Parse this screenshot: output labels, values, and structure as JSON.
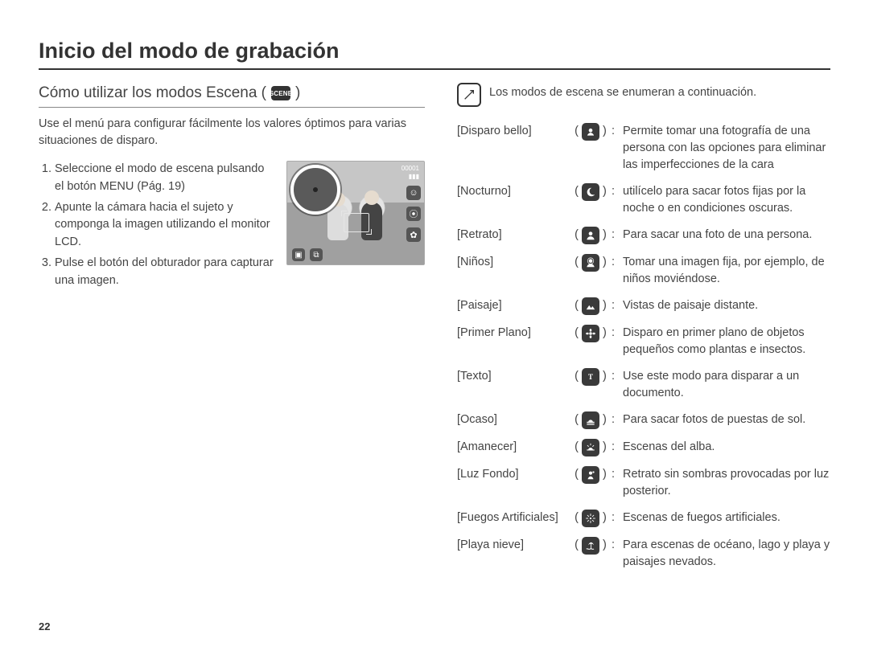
{
  "title": "Inicio del modo de grabación",
  "subheading_prefix": "Cómo utilizar los modos Escena (",
  "subheading_suffix": ")",
  "scene_badge": "SCENE",
  "intro": "Use el menú para configurar fácilmente los valores óptimos para varias situaciones de disparo.",
  "steps": [
    "Seleccione el modo de escena pulsando el botón MENU (Pág. 19)",
    "Apunte la cámara hacia el sujeto y componga la imagen utilizando el monitor LCD.",
    "Pulse el botón del obturador para capturar una imagen."
  ],
  "lcd": {
    "counter": "00001",
    "battery": "▮▮▮"
  },
  "note_text": "Los modos de escena se enumeran a continuación.",
  "modes": [
    {
      "label": "[Disparo bello]",
      "icon": "beauty",
      "desc": "Permite tomar una fotografía de una persona con las opciones para eliminar las imperfecciones de la cara"
    },
    {
      "label": "[Nocturno]",
      "icon": "night",
      "desc": "utilícelo para sacar fotos fijas por la noche o en condiciones oscuras."
    },
    {
      "label": "[Retrato]",
      "icon": "portrait",
      "desc": "Para sacar una foto de una persona."
    },
    {
      "label": "[Niños]",
      "icon": "children",
      "desc": "Tomar una imagen fija, por ejemplo, de niños moviéndose."
    },
    {
      "label": "[Paisaje]",
      "icon": "landscape",
      "desc": "Vistas de paisaje distante."
    },
    {
      "label": "[Primer Plano]",
      "icon": "closeup",
      "desc": "Disparo en primer plano de objetos pequeños como plantas e insectos."
    },
    {
      "label": "[Texto]",
      "icon": "text",
      "desc": "Use este modo para disparar a un documento."
    },
    {
      "label": "[Ocaso]",
      "icon": "sunset",
      "desc": "Para sacar fotos de puestas de sol."
    },
    {
      "label": "[Amanecer]",
      "icon": "sunrise",
      "desc": "Escenas del alba."
    },
    {
      "label": "[Luz Fondo]",
      "icon": "backlight",
      "desc": "Retrato sin sombras provocadas por luz posterior."
    },
    {
      "label": "[Fuegos Artificiales]",
      "icon": "fireworks",
      "desc": "Escenas de fuegos artificiales."
    },
    {
      "label": "[Playa nieve]",
      "icon": "beach",
      "desc": "Para escenas de océano, lago y playa y paisajes nevados."
    }
  ],
  "page_number": "22"
}
